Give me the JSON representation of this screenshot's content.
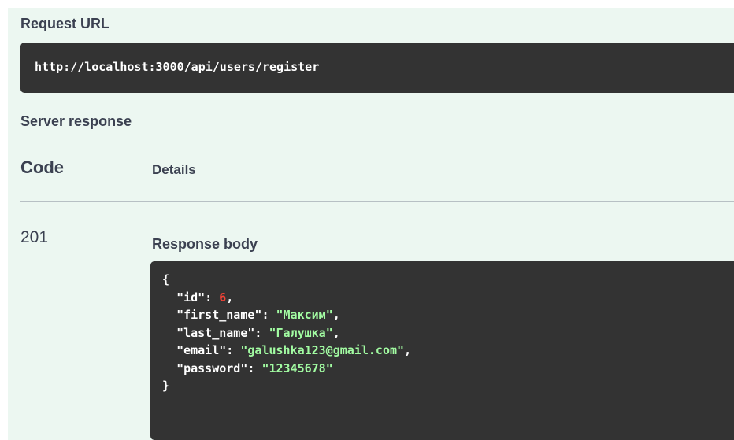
{
  "request_url": {
    "label": "Request URL",
    "url": "http://localhost:3000/api/users/register"
  },
  "server_response": {
    "label": "Server response",
    "columns": {
      "code": "Code",
      "details": "Details"
    },
    "row": {
      "code": "201",
      "response_body_label": "Response body",
      "body_lines": [
        {
          "open": "{"
        },
        {
          "key": "\"id\"",
          "sep": ": ",
          "num": "6",
          "end": ","
        },
        {
          "key": "\"first_name\"",
          "sep": ": ",
          "str": "\"Максим\"",
          "end": ","
        },
        {
          "key": "\"last_name\"",
          "sep": ": ",
          "str": "\"Галушка\"",
          "end": ","
        },
        {
          "key": "\"email\"",
          "sep": ": ",
          "str": "\"galushka123@gmail.com\"",
          "end": ","
        },
        {
          "key": "\"password\"",
          "sep": ": ",
          "str": "\"12345678\"",
          "end": ""
        },
        {
          "open": "}"
        }
      ]
    }
  },
  "colors": {
    "panel_bg": "#ecf7f1",
    "code_bg": "#333333",
    "text": "#3b4151",
    "json_number": "#f44336",
    "json_string": "#a2fca2"
  }
}
